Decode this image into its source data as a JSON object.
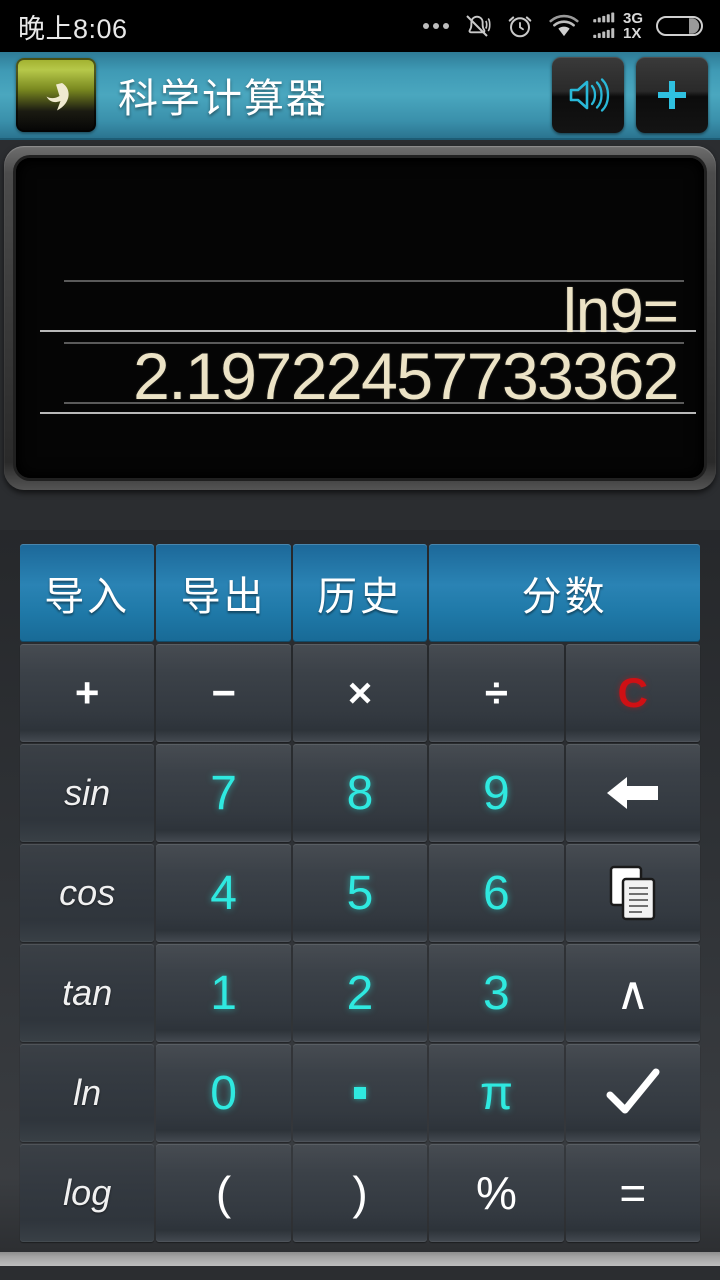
{
  "status_bar": {
    "time": "晚上8:06",
    "network_3g": "3G",
    "network_1x": "1X",
    "icons": [
      "more-dots",
      "mute-bell",
      "alarm-clock",
      "wifi",
      "signal-bars",
      "battery"
    ]
  },
  "title_bar": {
    "back_icon": "back-arrow-icon",
    "title": "科学计算器",
    "sound_icon": "speaker-icon",
    "add_icon": "plus-icon"
  },
  "display": {
    "expression": "ln9=",
    "result": "2.19722457733362",
    "text_color": "#ece3c6",
    "background": "#050505"
  },
  "keypad": {
    "rows": [
      [
        {
          "label": "导入",
          "name": "key-import",
          "style": "blue"
        },
        {
          "label": "导出",
          "name": "key-export",
          "style": "blue"
        },
        {
          "label": "历史",
          "name": "key-history",
          "style": "blue"
        },
        {
          "label": "分数",
          "name": "key-fraction",
          "style": "blue",
          "span": 2
        }
      ],
      [
        {
          "label": "+",
          "name": "key-plus",
          "style": "op"
        },
        {
          "label": "−",
          "name": "key-minus",
          "style": "op"
        },
        {
          "label": "×",
          "name": "key-multiply",
          "style": "op"
        },
        {
          "label": "÷",
          "name": "key-divide",
          "style": "op"
        },
        {
          "label": "C",
          "name": "key-clear",
          "style": "clear"
        }
      ],
      [
        {
          "label": "sin",
          "name": "key-sin",
          "style": "fnlab"
        },
        {
          "label": "7",
          "name": "key-7",
          "style": "digit"
        },
        {
          "label": "8",
          "name": "key-8",
          "style": "digit"
        },
        {
          "label": "9",
          "name": "key-9",
          "style": "digit"
        },
        {
          "label": "",
          "name": "key-backspace",
          "style": "icon",
          "icon": "backspace-arrow-icon"
        }
      ],
      [
        {
          "label": "cos",
          "name": "key-cos",
          "style": "fnlab"
        },
        {
          "label": "4",
          "name": "key-4",
          "style": "digit"
        },
        {
          "label": "5",
          "name": "key-5",
          "style": "digit"
        },
        {
          "label": "6",
          "name": "key-6",
          "style": "digit"
        },
        {
          "label": "",
          "name": "key-copy",
          "style": "icon",
          "icon": "copy-icon"
        }
      ],
      [
        {
          "label": "tan",
          "name": "key-tan",
          "style": "fnlab"
        },
        {
          "label": "1",
          "name": "key-1",
          "style": "digit"
        },
        {
          "label": "2",
          "name": "key-2",
          "style": "digit"
        },
        {
          "label": "3",
          "name": "key-3",
          "style": "digit"
        },
        {
          "label": "∧",
          "name": "key-power",
          "style": "sym"
        }
      ],
      [
        {
          "label": "ln",
          "name": "key-ln",
          "style": "fnlab"
        },
        {
          "label": "0",
          "name": "key-0",
          "style": "digit"
        },
        {
          "label": "",
          "name": "key-decimal",
          "style": "dot"
        },
        {
          "label": "π",
          "name": "key-pi",
          "style": "digit"
        },
        {
          "label": "",
          "name": "key-confirm",
          "style": "icon",
          "icon": "checkmark-icon"
        }
      ],
      [
        {
          "label": "log",
          "name": "key-log",
          "style": "fnlab"
        },
        {
          "label": "(",
          "name": "key-paren-open",
          "style": "sym"
        },
        {
          "label": ")",
          "name": "key-paren-close",
          "style": "sym"
        },
        {
          "label": "%",
          "name": "key-percent",
          "style": "sym"
        },
        {
          "label": "=",
          "name": "key-equals",
          "style": "sym"
        }
      ]
    ]
  },
  "colors": {
    "accent_cyan": "#2fe9e0",
    "blue_key": "#2a83b4",
    "clear_red": "#d01014",
    "titlebar_teal": "#4aa7bf",
    "display_text": "#ece3c6"
  }
}
